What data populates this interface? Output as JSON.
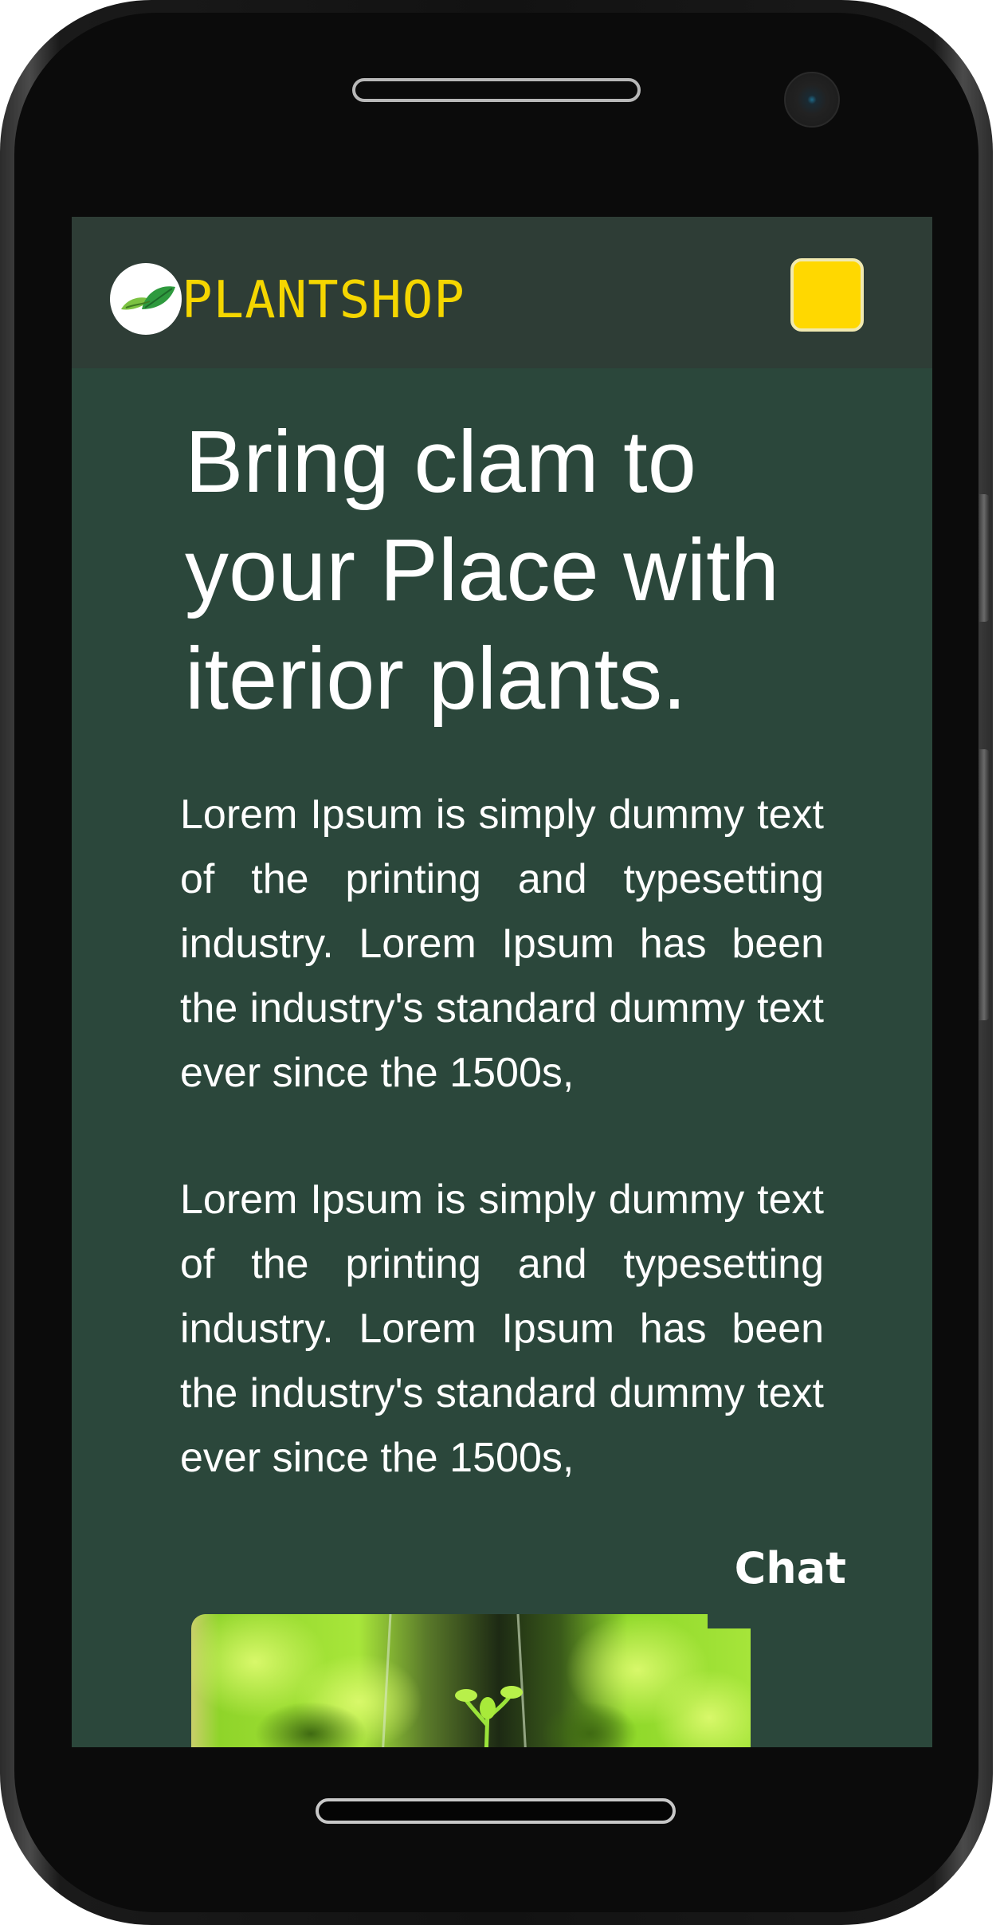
{
  "navbar": {
    "brand": "PLANTSHOP",
    "logo_icon": "leaf-icon",
    "menu_icon": "menu-icon",
    "accent_color": "#ffd800"
  },
  "hero": {
    "title": "Bring clam to your Place with iterior plants.",
    "paragraphs": [
      "Lorem Ipsum is simply dummy text of the printing and typesetting industry. Lorem Ipsum has been the industry's standard dummy text ever since the 1500s,",
      "Lorem Ipsum is simply dummy text of the printing and typesetting industry. Lorem Ipsum has been the industry's standard dummy text ever since the 1500s,"
    ]
  },
  "chat": {
    "label": "Chat"
  },
  "colors": {
    "background": "#2b473b",
    "navbar": "#2e3d36",
    "brand_text": "#f5d600",
    "text": "#ffffff"
  }
}
